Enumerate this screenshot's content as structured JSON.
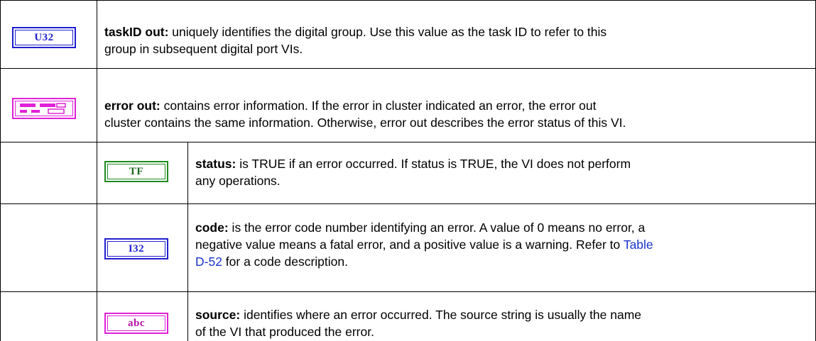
{
  "rows": {
    "taskid_out": {
      "icon": "U32",
      "term": "taskID out:",
      "desc_line1": " uniquely identifies the digital group. Use this value as the task ID to refer to this",
      "desc_line2": "group in subsequent digital port VIs."
    },
    "error_out": {
      "icon": "cluster-icon",
      "term": "error out:",
      "desc_line1": " contains error information. If the error in cluster indicated an error, the error out",
      "desc_line2": "cluster contains the same information. Otherwise, error out describes the error status of this VI."
    },
    "status": {
      "icon": "TF",
      "term": "status:",
      "desc_line1": " is TRUE if an error occurred.  If status is TRUE, the VI does not perform",
      "desc_line2": "any operations."
    },
    "code": {
      "icon": "I32",
      "term": "code:",
      "desc_line1": " is the error code number identifying an error.  A value of 0 means no error, a",
      "desc_line2_pre": "negative value means a fatal error, and a positive value is a warning. Refer to ",
      "link_part1": "Table",
      "link_part2": "D-52",
      "desc_line3_post": " for a code description."
    },
    "source": {
      "icon": "abc",
      "term": "source:",
      "desc_line1": " identifies where an error occurred.  The source string is usually the name",
      "desc_line2": "of the VI that produced the error."
    }
  },
  "colors": {
    "numeric_blue": "#1f1fd0",
    "boolean_green": "#1f8a1f",
    "string_pink": "#e020d8",
    "link_blue": "#1a34c9"
  }
}
